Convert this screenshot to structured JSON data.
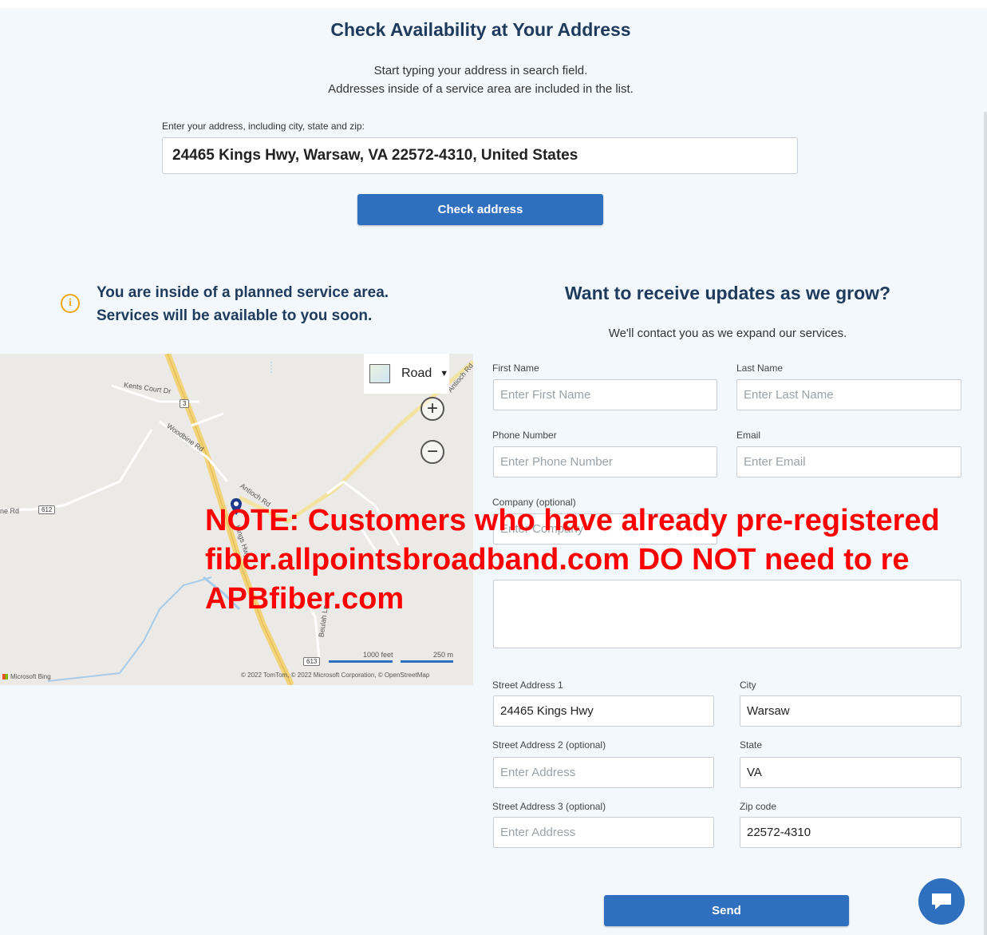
{
  "availability": {
    "title": "Check Availability at Your Address",
    "subtitle_line1": "Start typing your address in search field.",
    "subtitle_line2": "Addresses inside of a service area are included in the list.",
    "address_label": "Enter your address, including city, state and zip:",
    "address_value": "24465 Kings Hwy, Warsaw, VA 22572-4310, United States",
    "check_button": "Check address"
  },
  "status": {
    "icon": "info-icon",
    "line1": "You are inside of a planned service area.",
    "line2": "Services will be available to you soon."
  },
  "map": {
    "type_label": "Road",
    "labels": {
      "kents_court": "Kents Court Dr",
      "woodbine": "Woodbine Rd",
      "antioch": "Antioch Rd",
      "antioch_ne": "Antioch Rd",
      "kings": "Kings Hwy",
      "beulah": "Beulah Ln",
      "left_rd": "ne Rd"
    },
    "shields": {
      "r3": "3",
      "r612": "612",
      "r613": "613"
    },
    "scale_feet": "1000 feet",
    "scale_m": "250 m",
    "bing": "Microsoft Bing",
    "copyright": "© 2022 TomTom, © 2022 Microsoft Corporation, © OpenStreetMap"
  },
  "form": {
    "title": "Want to receive updates as we grow?",
    "subtitle": "We'll contact you as we expand our services.",
    "first_name": {
      "label": "First Name",
      "placeholder": "Enter First Name"
    },
    "last_name": {
      "label": "Last Name",
      "placeholder": "Enter Last Name"
    },
    "phone": {
      "label": "Phone Number",
      "placeholder": "Enter Phone Number"
    },
    "email": {
      "label": "Email",
      "placeholder": "Enter Email"
    },
    "company": {
      "label": "Company (optional)",
      "placeholder": "Enter Company"
    },
    "street1": {
      "label": "Street Address 1",
      "value": "24465 Kings Hwy"
    },
    "city": {
      "label": "City",
      "value": "Warsaw"
    },
    "street2": {
      "label": "Street Address 2 (optional)",
      "placeholder": "Enter Address"
    },
    "state": {
      "label": "State",
      "value": "VA"
    },
    "street3": {
      "label": "Street Address 3 (optional)",
      "placeholder": "Enter Address"
    },
    "zip": {
      "label": "Zip code",
      "value": "22572-4310"
    },
    "send_button": "Send"
  },
  "note": {
    "line1": "NOTE: Customers who have already pre-registered",
    "line2": "fiber.allpointsbroadband.com DO NOT need to re",
    "line3": "APBfiber.com"
  },
  "colors": {
    "accent": "#2f6fbf",
    "warning": "#f0a91c",
    "note": "#ff0000",
    "heading": "#1e3a5c"
  }
}
